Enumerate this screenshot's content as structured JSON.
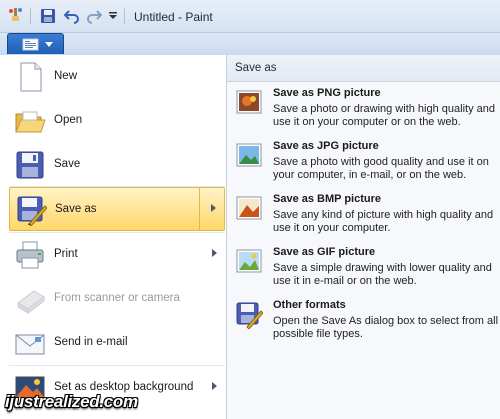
{
  "window": {
    "title": "Untitled - Paint"
  },
  "menu": {
    "items": [
      {
        "label": "New",
        "icon": "new-document-icon",
        "submenu": false,
        "disabled": false
      },
      {
        "label": "Open",
        "icon": "open-folder-icon",
        "submenu": false,
        "disabled": false
      },
      {
        "label": "Save",
        "icon": "save-disk-icon",
        "submenu": false,
        "disabled": false
      },
      {
        "label": "Save as",
        "icon": "save-as-icon",
        "submenu": true,
        "disabled": false,
        "highlighted": true
      },
      {
        "label": "Print",
        "icon": "printer-icon",
        "submenu": true,
        "disabled": false
      },
      {
        "label": "From scanner or camera",
        "icon": "scanner-icon",
        "submenu": false,
        "disabled": true
      },
      {
        "label": "Send in e-mail",
        "icon": "email-icon",
        "submenu": false,
        "disabled": false
      },
      {
        "label": "Set as desktop background",
        "icon": "desktop-background-icon",
        "submenu": true,
        "disabled": false
      }
    ]
  },
  "save_as_panel": {
    "header": "Save as",
    "formats": [
      {
        "title": "Save as PNG picture",
        "description": "Save a photo or drawing with high quality and use it on your computer or on the web.",
        "icon": "png-picture-icon"
      },
      {
        "title": "Save as JPG picture",
        "description": "Save a photo with good quality and use it on your computer, in e-mail, or on the web.",
        "icon": "jpg-picture-icon"
      },
      {
        "title": "Save as BMP picture",
        "description": "Save any kind of picture with high quality and use it on your computer.",
        "icon": "bmp-picture-icon"
      },
      {
        "title": "Save as GIF picture",
        "description": "Save a simple drawing with lower quality and use it in e-mail or on the web.",
        "icon": "gif-picture-icon"
      },
      {
        "title": "Other formats",
        "description": "Open the Save As dialog box to select from all possible file types.",
        "icon": "other-formats-icon"
      }
    ]
  },
  "watermark": "ijustrealized.com",
  "colors": {
    "accent": "#2a6fc9",
    "highlight": "#ffd768"
  }
}
